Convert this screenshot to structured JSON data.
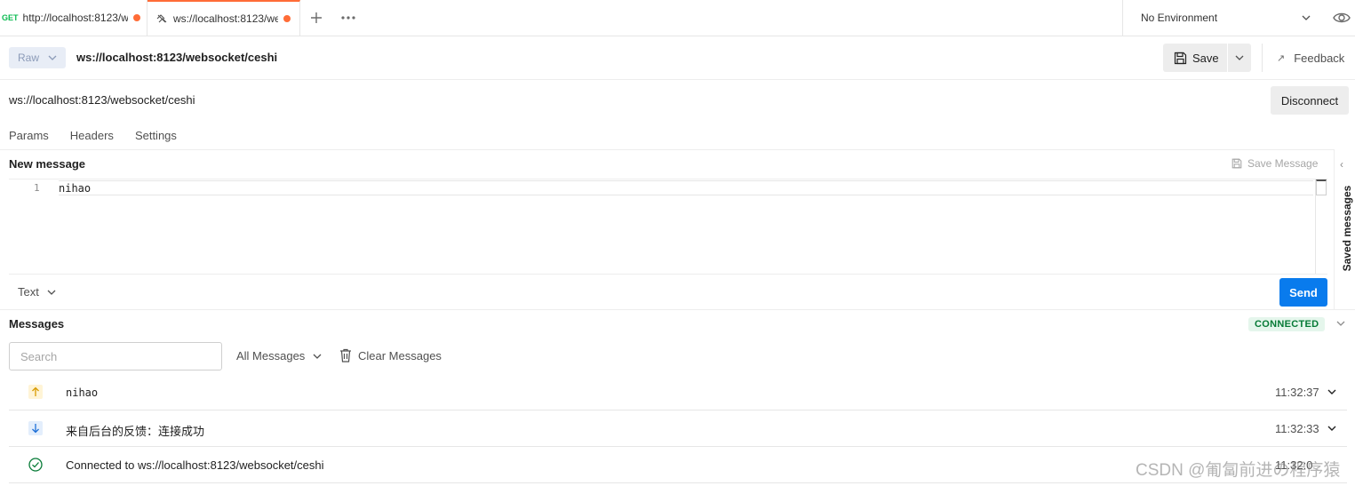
{
  "tabs": [
    {
      "method": "GET",
      "title": "http://localhost:8123/w"
    },
    {
      "title": "ws://localhost:8123/we"
    }
  ],
  "environment": "No Environment",
  "request": {
    "format_label": "Raw",
    "name": "ws://localhost:8123/websocket/ceshi",
    "save_label": "Save",
    "feedback_label": "Feedback",
    "url": "ws://localhost:8123/websocket/ceshi",
    "disconnect_label": "Disconnect"
  },
  "subtabs": [
    "Params",
    "Headers",
    "Settings"
  ],
  "new_message": {
    "title": "New message",
    "save_message_label": "Save Message",
    "line_number": "1",
    "content": "nihao",
    "format": "Text",
    "send_label": "Send",
    "saved_messages_label": "Saved messages"
  },
  "messages": {
    "title": "Messages",
    "status": "CONNECTED",
    "search_placeholder": "Search",
    "filter": "All Messages",
    "clear_label": "Clear Messages",
    "items": [
      {
        "direction": "sent",
        "text": "nihao",
        "time": "11:32:37"
      },
      {
        "direction": "received",
        "text": "来自后台的反馈：连接成功",
        "time": "11:32:33"
      },
      {
        "direction": "connected",
        "text": "Connected to ws://localhost:8123/websocket/ceshi",
        "time": "11:32:0"
      }
    ]
  },
  "watermark": "CSDN @匍匐前进の程序猿",
  "colors": {
    "accent": "#ff6c37",
    "send": "#097bed",
    "connected_bg": "#e5f6ec",
    "connected_text": "#067a36"
  }
}
